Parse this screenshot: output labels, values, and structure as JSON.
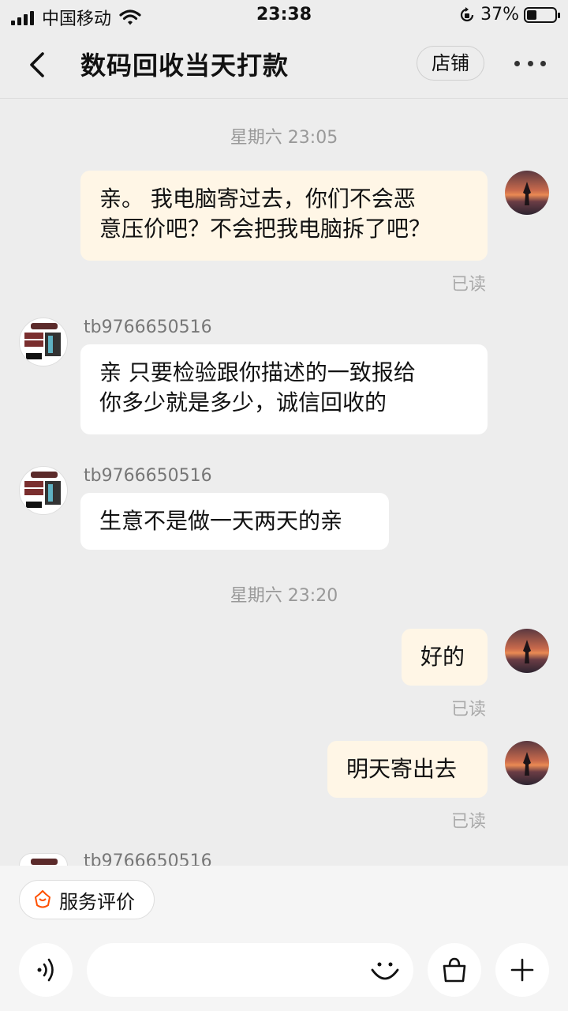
{
  "status_bar": {
    "carrier": "中国移动",
    "time": "23:38",
    "battery": "37%"
  },
  "header": {
    "title": "数码回收当天打款",
    "shop_button": "店铺"
  },
  "messages": {
    "ts1": "星期六 23:05",
    "m1_line1": "亲。 我电脑寄过去，你们不会恶",
    "m1_line2": "意压价吧？不会把我电脑拆了吧？",
    "m1_read": "已读",
    "m2_sender": "tb9766650516",
    "m2_line1": "亲 只要检验跟你描述的一致报给",
    "m2_line2": "你多少就是多少，诚信回收的",
    "m3_sender": "tb9766650516",
    "m3_text": "生意不是做一天两天的亲",
    "ts2": "星期六 23:20",
    "m4_text": "好的",
    "m4_read": "已读",
    "m5_text": "明天寄出去",
    "m5_read": "已读",
    "m6_sender": "tb9766650516"
  },
  "bottom": {
    "service_rating": "服务评价"
  },
  "colors": {
    "accent": "#ff5000",
    "outgoing_bubble": "#fff6e6",
    "incoming_bubble": "#ffffff",
    "background": "#ededed"
  },
  "icons": {
    "back": "chevron-left-icon",
    "more": "more-dots-icon",
    "voice": "voice-icon",
    "emoji": "smile-icon",
    "shop_bag": "bag-icon",
    "plus": "plus-icon"
  }
}
